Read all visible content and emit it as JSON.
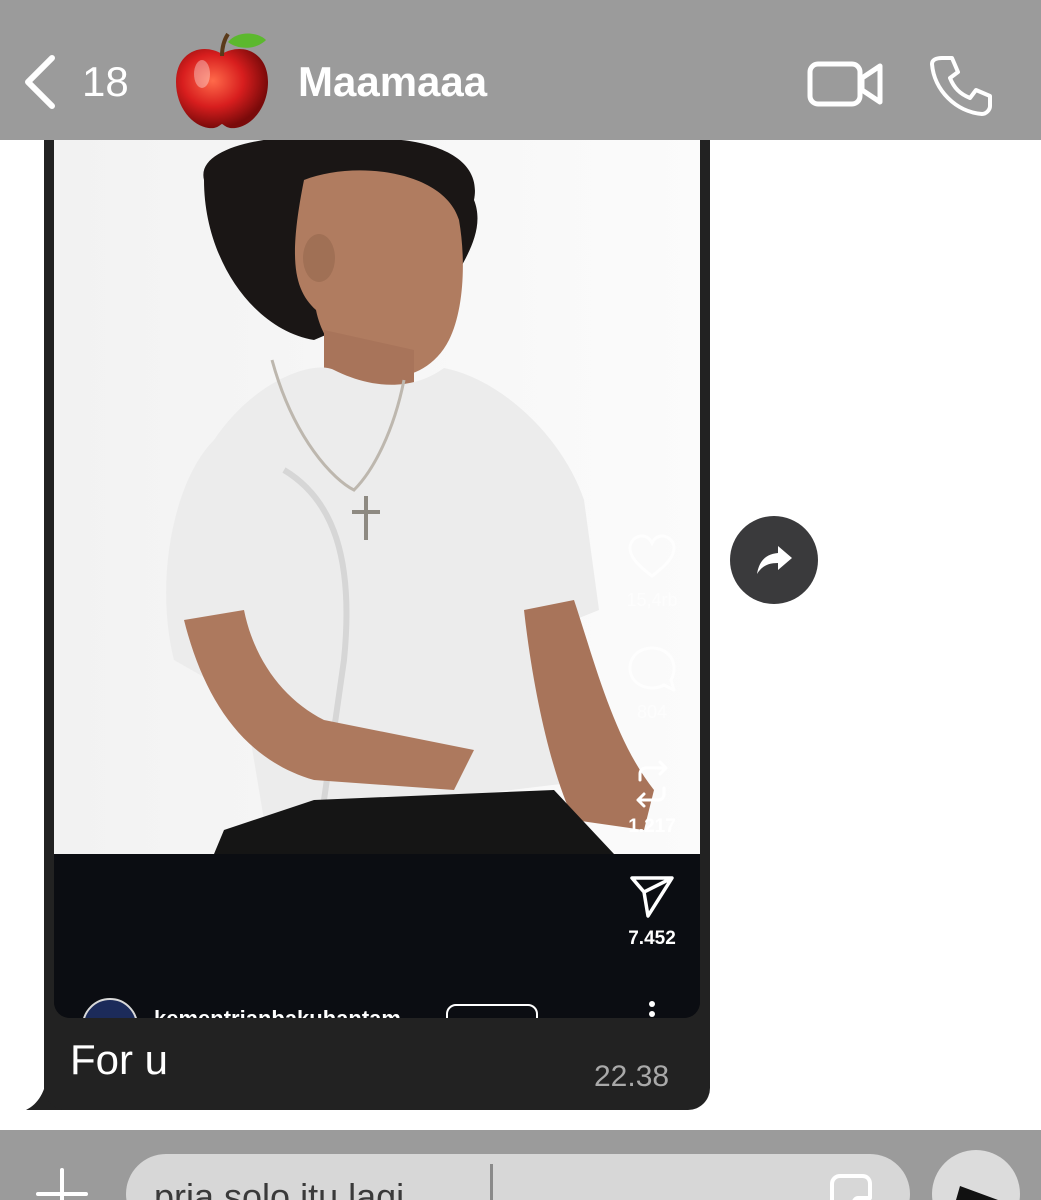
{
  "header": {
    "back_count": "18",
    "contact_name": "Maamaaa",
    "bar_color": "#9b9b9b",
    "avatar_icon": "apple-icon"
  },
  "message": {
    "reel": {
      "likes": "15,4rb",
      "comments": "804",
      "reposts": "1.217",
      "shares": "7.452",
      "author": "kementrianbakuhantam",
      "icons": [
        "heart-icon",
        "comment-icon",
        "repost-icon",
        "send-icon",
        "more-icon"
      ]
    },
    "caption": "For u",
    "time": "22.38"
  },
  "composer": {
    "input_value": "pria solo itu lagi",
    "icons": [
      "plus-icon",
      "sticker-icon",
      "send-icon"
    ]
  }
}
